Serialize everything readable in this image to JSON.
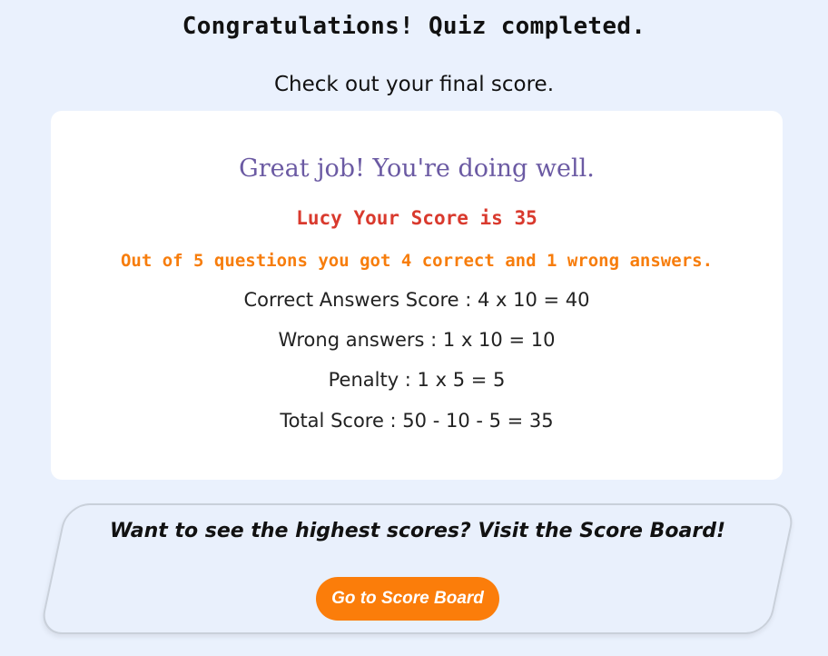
{
  "header": {
    "title": "Congratulations! Quiz completed.",
    "subtitle": "Check out your final score."
  },
  "result": {
    "feedback": "Great job! You're doing well.",
    "score_line": "Lucy Your Score is 35",
    "summary": "Out of 5 questions you got 4 correct and 1 wrong answers.",
    "correct_line": "Correct Answers Score : 4 x 10 = 40",
    "wrong_line": "Wrong answers : 1 x 10 = 10",
    "penalty_line": "Penalty : 1 x 5 = 5",
    "total_line": "Total Score : 50 - 10 - 5 = 35"
  },
  "scoreboard_promo": {
    "text": "Want to see the highest scores? Visit the Score Board!",
    "button_label": "Go to Score Board"
  },
  "colors": {
    "background": "#eaf1fd",
    "feedback": "#6b5aa3",
    "score_line": "#d93a2e",
    "summary": "#f77d0c",
    "button": "#fb7d0a"
  }
}
